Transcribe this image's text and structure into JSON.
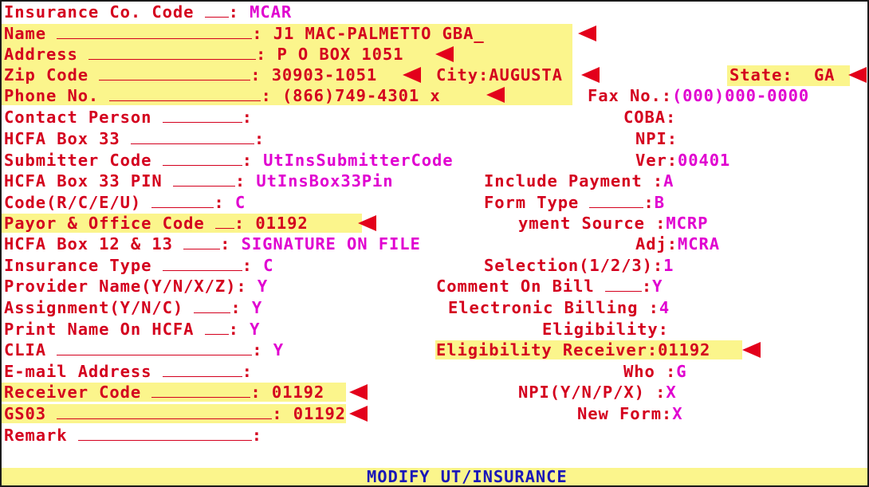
{
  "colors": {
    "label": "#d4001e",
    "value": "#e000d0",
    "highlight": "#fbf58c",
    "arrow": "#e3001b",
    "status": "#1a17b8"
  },
  "left": {
    "ins_code": {
      "label": "Insurance Co. Code",
      "value": "MCAR"
    },
    "name": {
      "label": "Name",
      "value": "J1 MAC-PALMETTO GBA"
    },
    "address": {
      "label": "Address",
      "value": "P O BOX 1051"
    },
    "zip": {
      "label": "Zip Code",
      "value": "30903-1051"
    },
    "phone": {
      "label": "Phone No.",
      "value": "(866)749-4301 x"
    },
    "contact": {
      "label": "Contact Person",
      "value": ""
    },
    "hcfa33": {
      "label": "HCFA Box 33",
      "value": ""
    },
    "submitter": {
      "label": "Submitter Code",
      "value": "UtInsSubmitterCode"
    },
    "hcfa33pin": {
      "label": "HCFA Box 33 PIN",
      "value": "UtInsBox33Pin"
    },
    "code_rceu": {
      "label": "Code(R/C/E/U)",
      "value": "C"
    },
    "payor": {
      "label": "Payor & Office Code",
      "value": "01192"
    },
    "hcfa1213": {
      "label": "HCFA Box 12 & 13",
      "value": "SIGNATURE ON FILE"
    },
    "ins_type": {
      "label": "Insurance Type",
      "value": "C"
    },
    "prov_name": {
      "label": "Provider Name(Y/N/X/Z)",
      "value": "Y"
    },
    "assignment": {
      "label": "Assignment(Y/N/C)",
      "value": "Y"
    },
    "print_name": {
      "label": "Print Name On HCFA",
      "value": "Y"
    },
    "clia": {
      "label": "CLIA",
      "value": "Y"
    },
    "email": {
      "label": "E-mail Address",
      "value": ""
    },
    "receiver": {
      "label": "Receiver Code",
      "value": "01192"
    },
    "gs03": {
      "label": "GS03",
      "value": "01192"
    },
    "remark": {
      "label": "Remark",
      "value": ""
    }
  },
  "right": {
    "city": {
      "label": "City:",
      "value": "AUGUSTA"
    },
    "state": {
      "label": "State:",
      "value": "GA"
    },
    "fax": {
      "label": "Fax No.:",
      "value": "(000)000-0000"
    },
    "coba": {
      "label": "COBA:",
      "value": ""
    },
    "npi": {
      "label": "NPI:",
      "value": ""
    },
    "ver": {
      "label": "Ver:",
      "value": "00401"
    },
    "include_payment": {
      "label": "Include Payment :",
      "value": "A"
    },
    "form_type": {
      "label": "Form Type",
      "value": "B"
    },
    "payment_source": {
      "label": "yment Source :",
      "value": "MCRP"
    },
    "adj": {
      "label": "Adj:",
      "value": "MCRA"
    },
    "selection": {
      "label": "Selection(1/2/3):",
      "value": "1"
    },
    "comment": {
      "label": "Comment On Bill",
      "value": "Y"
    },
    "ebilling": {
      "label": "Electronic Billing :",
      "value": "4"
    },
    "eligibility": {
      "label": "Eligibility:",
      "value": ""
    },
    "elig_receiver": {
      "label": "Eligibility Receiver:",
      "value": "01192"
    },
    "who": {
      "label": "Who :",
      "value": "G"
    },
    "npi_ynpx": {
      "label": "NPI(Y/N/P/X) :",
      "value": "X"
    },
    "new_form": {
      "label": "New Form:",
      "value": "X"
    }
  },
  "cursor": "_",
  "status_bar": "MODIFY UT/INSURANCE"
}
